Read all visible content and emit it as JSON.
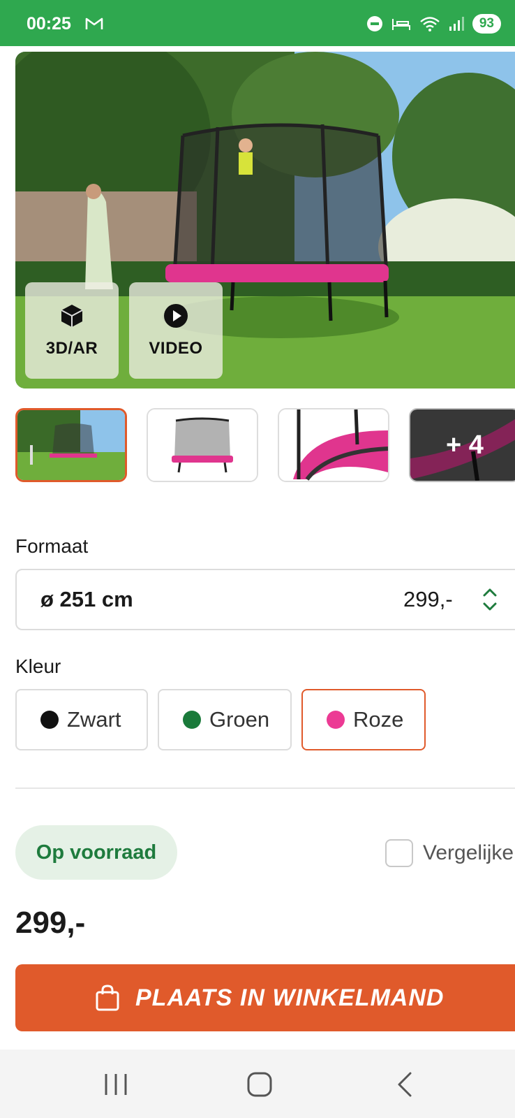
{
  "status_bar": {
    "time": "00:25",
    "battery": "93",
    "mail_icon": "gmail-icon"
  },
  "media_buttons": {
    "ar_label": "3D/AR",
    "video_label": "VIDEO"
  },
  "thumbnails": {
    "more_label": "+ 4"
  },
  "format": {
    "label": "Formaat",
    "selected_size": "ø 251 cm",
    "selected_price": "299,-"
  },
  "color": {
    "label": "Kleur",
    "options": [
      {
        "name": "Zwart",
        "swatch": "#111111"
      },
      {
        "name": "Groen",
        "swatch": "#1a7a3a"
      },
      {
        "name": "Roze",
        "swatch": "#ec3a94"
      }
    ],
    "selected": "Roze"
  },
  "stock": {
    "label": "Op voorraad"
  },
  "compare": {
    "label": "Vergelijken"
  },
  "price": "299,-",
  "cart_button": {
    "label": "PLAATS IN WINKELMAND"
  },
  "colors": {
    "brand_green": "#2fa84f",
    "accent_orange": "#e05a2b",
    "stock_green": "#1e7b3d"
  }
}
